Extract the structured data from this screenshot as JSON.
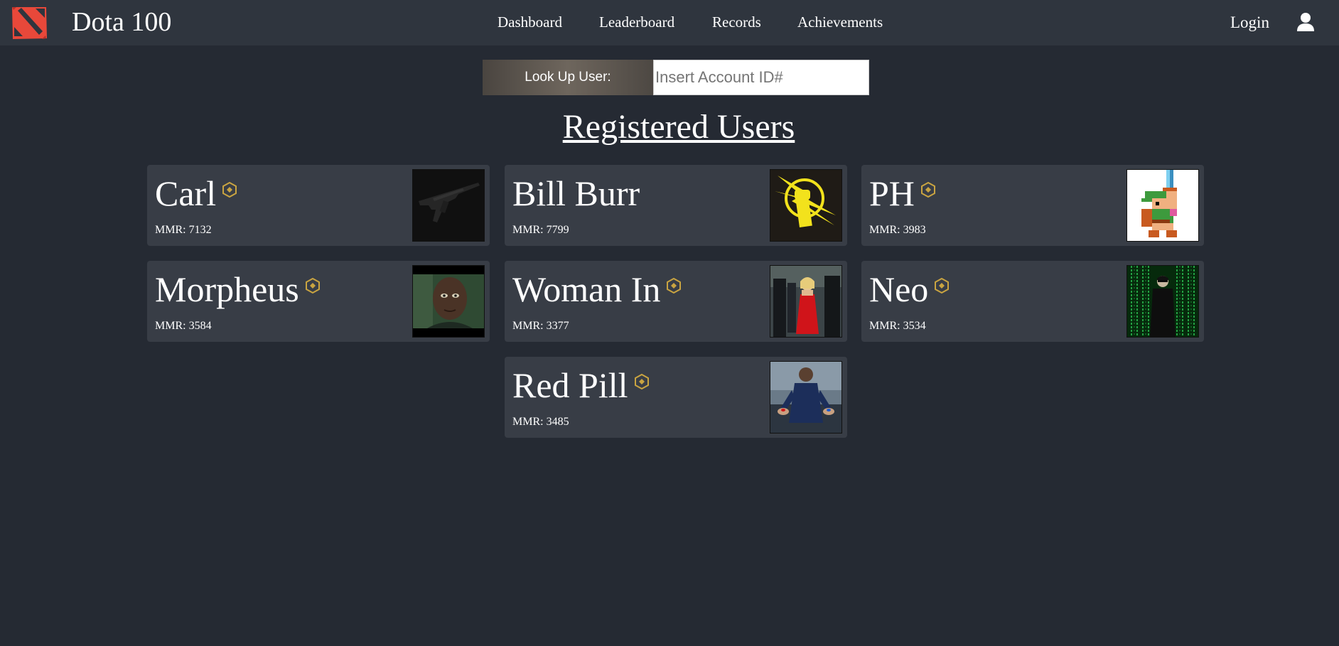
{
  "app": {
    "title": "Dota 100"
  },
  "nav": {
    "items": [
      {
        "label": "Dashboard"
      },
      {
        "label": "Leaderboard"
      },
      {
        "label": "Records"
      },
      {
        "label": "Achievements"
      }
    ],
    "login_label": "Login",
    "user_icon": "user-icon",
    "logo_icon": "dota-logo-icon"
  },
  "lookup": {
    "label": "Look Up User:",
    "placeholder": "Insert Account ID#"
  },
  "page_title": "Registered Users",
  "users": [
    {
      "name": "Carl",
      "mmr": "MMR: 7132",
      "badge": true,
      "avatar": "rifle-image"
    },
    {
      "name": "Bill Burr",
      "mmr": "MMR: 7799",
      "badge": false,
      "avatar": "yellow-fist-lightning-image"
    },
    {
      "name": "PH",
      "mmr": "MMR: 3983",
      "badge": true,
      "avatar": "pixel-hero-sword-image"
    },
    {
      "name": "Morpheus",
      "mmr": "MMR: 3584",
      "badge": true,
      "avatar": "morpheus-portrait-image"
    },
    {
      "name": "Woman In",
      "mmr": "MMR: 3377",
      "badge": true,
      "avatar": "woman-in-red-image"
    },
    {
      "name": "Neo",
      "mmr": "MMR: 3534",
      "badge": true,
      "avatar": "neo-matrix-code-image"
    },
    {
      "name": "Red Pill",
      "mmr": "MMR: 3485",
      "badge": true,
      "avatar": "red-blue-pill-image"
    }
  ],
  "colors": {
    "background": "#252a33",
    "navbar": "#2f353e",
    "card": "#383d46",
    "badge": "#c9a441",
    "logo": "#e8483a"
  }
}
